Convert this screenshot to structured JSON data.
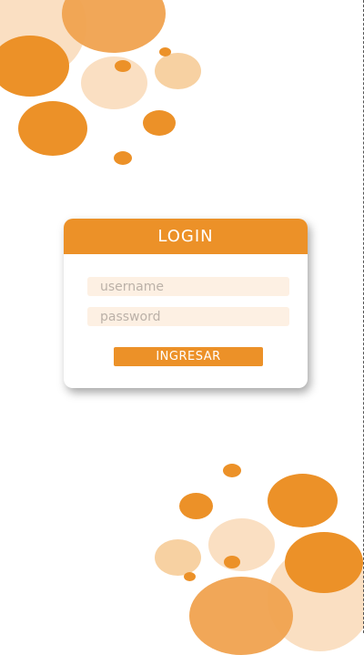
{
  "login": {
    "title": "LOGIN",
    "username_placeholder": "username",
    "password_placeholder": "password",
    "submit_label": "INGRESAR"
  },
  "colors": {
    "accent": "#ec9128",
    "field_bg": "#fdf0e3",
    "light_bubble": "#f6c992",
    "pale_bubble": "#f9dcbb"
  }
}
